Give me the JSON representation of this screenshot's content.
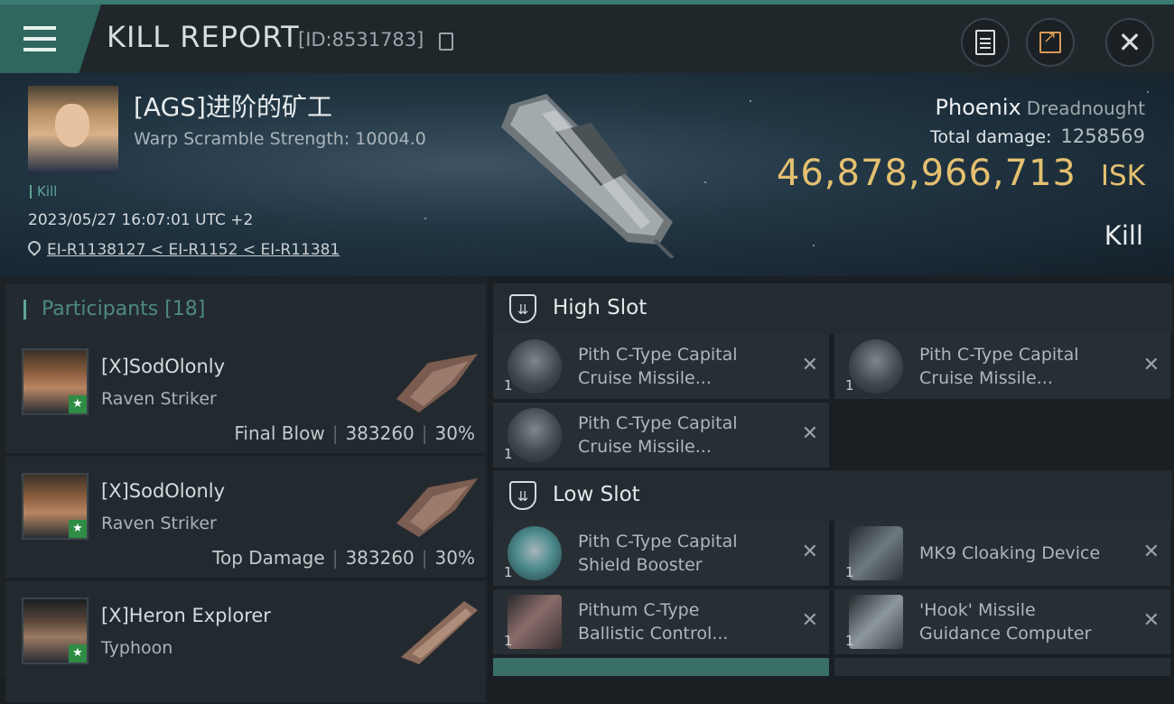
{
  "header": {
    "title": "KILL REPORT",
    "report_id": "[ID:8531783]",
    "accent": "#3b7c72"
  },
  "victim": {
    "name": "[AGS]进阶的矿工",
    "warp_scramble": "Warp Scramble Strength: 10004.0",
    "tag": "Kill",
    "timestamp": "2023/05/27 16:07:01 UTC +2",
    "location": "EI-R1138127 < EI-R1152 < EI-R11381",
    "ship_name": "Phoenix",
    "ship_class": "Dreadnought",
    "total_damage_label": "Total damage:",
    "total_damage": "1258569",
    "isk_value": "46,878,966,713",
    "isk_unit": "ISK",
    "result": "Kill"
  },
  "participants": {
    "heading": "Participants [18]",
    "rows": [
      {
        "name": "[X]SodOlonly",
        "ship": "Raven Striker",
        "role": "Final Blow",
        "damage": "383260",
        "percent": "30%"
      },
      {
        "name": "[X]SodOlonly",
        "ship": "Raven Striker",
        "role": "Top Damage",
        "damage": "383260",
        "percent": "30%"
      },
      {
        "name": "[X]Heron Explorer",
        "ship": "Typhoon",
        "role": "",
        "damage": "",
        "percent": ""
      }
    ]
  },
  "slots": {
    "high": {
      "title": "High Slot",
      "items": [
        {
          "name_line1": "Pith C-Type Capital",
          "name_line2": "Cruise Missile...",
          "qty": "1"
        },
        {
          "name_line1": "Pith C-Type Capital",
          "name_line2": "Cruise Missile...",
          "qty": "1"
        },
        {
          "name_line1": "Pith C-Type Capital",
          "name_line2": "Cruise Missile...",
          "qty": "1"
        }
      ]
    },
    "low": {
      "title": "Low Slot",
      "items": [
        {
          "name_line1": "Pith C-Type Capital",
          "name_line2": "Shield Booster",
          "qty": "1"
        },
        {
          "name_line1": "MK9 Cloaking Device",
          "name_line2": "",
          "qty": "1"
        },
        {
          "name_line1": "Pithum C-Type",
          "name_line2": "Ballistic Control...",
          "qty": "1"
        },
        {
          "name_line1": "'Hook' Missile",
          "name_line2": "Guidance Computer",
          "qty": "1"
        }
      ]
    }
  }
}
